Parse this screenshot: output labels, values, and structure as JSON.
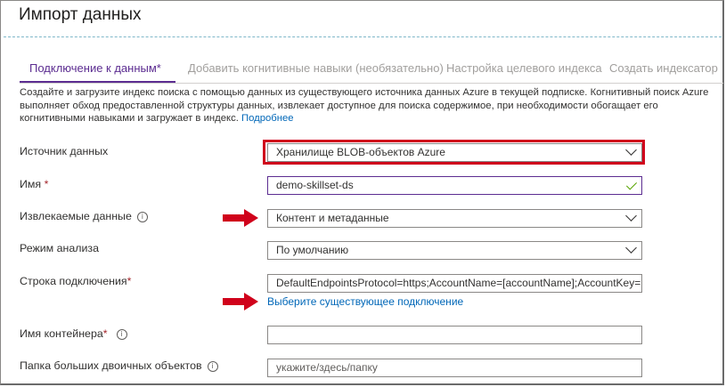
{
  "window": {
    "title": "Импорт данных"
  },
  "tabs": [
    {
      "label": "Подключение к данным",
      "star": "*",
      "state": "active"
    },
    {
      "label": "Добавить когнитивные навыки (необязательно)",
      "state": "inactive"
    },
    {
      "label": "Настройка целевого индекса",
      "state": "inactive"
    },
    {
      "label": "Создать индексатор",
      "state": "inactive"
    }
  ],
  "description": {
    "text": "Создайте и загрузите индекс поиска с помощью данных из существующего источника данных Azure в текущей подписке. Когнитивный поиск Azure выполняет обход предоставленной структуры данных, извлекает доступное для поиска содержимое, при необходимости обогащает его когнитивными навыками и загружает в индекс.",
    "link": "Подробнее"
  },
  "form": {
    "data_source": {
      "label": "Источник данных",
      "value": "Хранилище BLOB-объектов Azure"
    },
    "name": {
      "label": "Имя",
      "required": "*",
      "value": "demo-skillset-ds"
    },
    "extract": {
      "label": "Извлекаемые данные",
      "info": "i",
      "value": "Контент и метаданные"
    },
    "parse_mode": {
      "label": "Режим анализа",
      "value": "По умолчанию"
    },
    "connection": {
      "label": "Строка подключения",
      "required": "*",
      "value": "DefaultEndpointsProtocol=https;AccountName=[accountName];AccountKey=[accountKey]",
      "link": "Выберите существующее подключение"
    },
    "container": {
      "label": "Имя контейнера",
      "required": "*",
      "info": "i",
      "value": ""
    },
    "blob_folder": {
      "label": "Папка больших двоичных объектов",
      "info": "i",
      "placeholder": "укажите/здесь/папку"
    }
  },
  "colors": {
    "accent": "#5c2d91",
    "link": "#0067b8",
    "annotation_red": "#d0021b",
    "valid_check": "#57a300"
  }
}
